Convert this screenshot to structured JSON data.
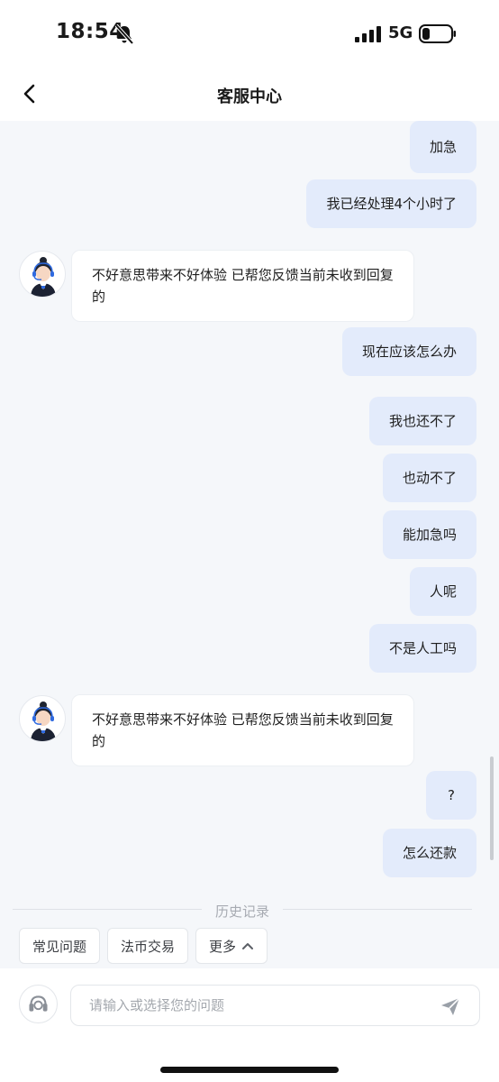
{
  "status_bar": {
    "time": "18:54",
    "network": "5G",
    "icons": [
      "bell-slash-icon",
      "signal-icon",
      "battery-icon"
    ]
  },
  "nav": {
    "title": "客服中心",
    "back_icon": "chevron-left-icon"
  },
  "messages": [
    {
      "from": "user",
      "text": "加急"
    },
    {
      "from": "user",
      "text": "我已经处理4个小时了"
    },
    {
      "from": "agent",
      "text": "不好意思带来不好体验 已帮您反馈当前未收到回复的"
    },
    {
      "from": "user",
      "text": "现在应该怎么办"
    },
    {
      "from": "user",
      "text": "我也还不了"
    },
    {
      "from": "user",
      "text": "也动不了"
    },
    {
      "from": "user",
      "text": "能加急吗"
    },
    {
      "from": "user",
      "text": "人呢"
    },
    {
      "from": "user",
      "text": "不是人工吗"
    },
    {
      "from": "agent",
      "text": "不好意思带来不好体验 已帮您反馈当前未收到回复的"
    },
    {
      "from": "user",
      "text": "?"
    },
    {
      "from": "user",
      "text": "怎么还款"
    }
  ],
  "history_label": "历史记录",
  "quick_chips": [
    {
      "label": "常见问题"
    },
    {
      "label": "法币交易"
    },
    {
      "label": "更多",
      "icon": "chevron-up-icon"
    }
  ],
  "input": {
    "placeholder": "请输入或选择您的问题",
    "value": ""
  },
  "colors": {
    "user_bubble": "#e3ebfb",
    "agent_bubble": "#ffffff",
    "chat_bg": "#f5f7fa",
    "accent": "#3b6fe0"
  }
}
